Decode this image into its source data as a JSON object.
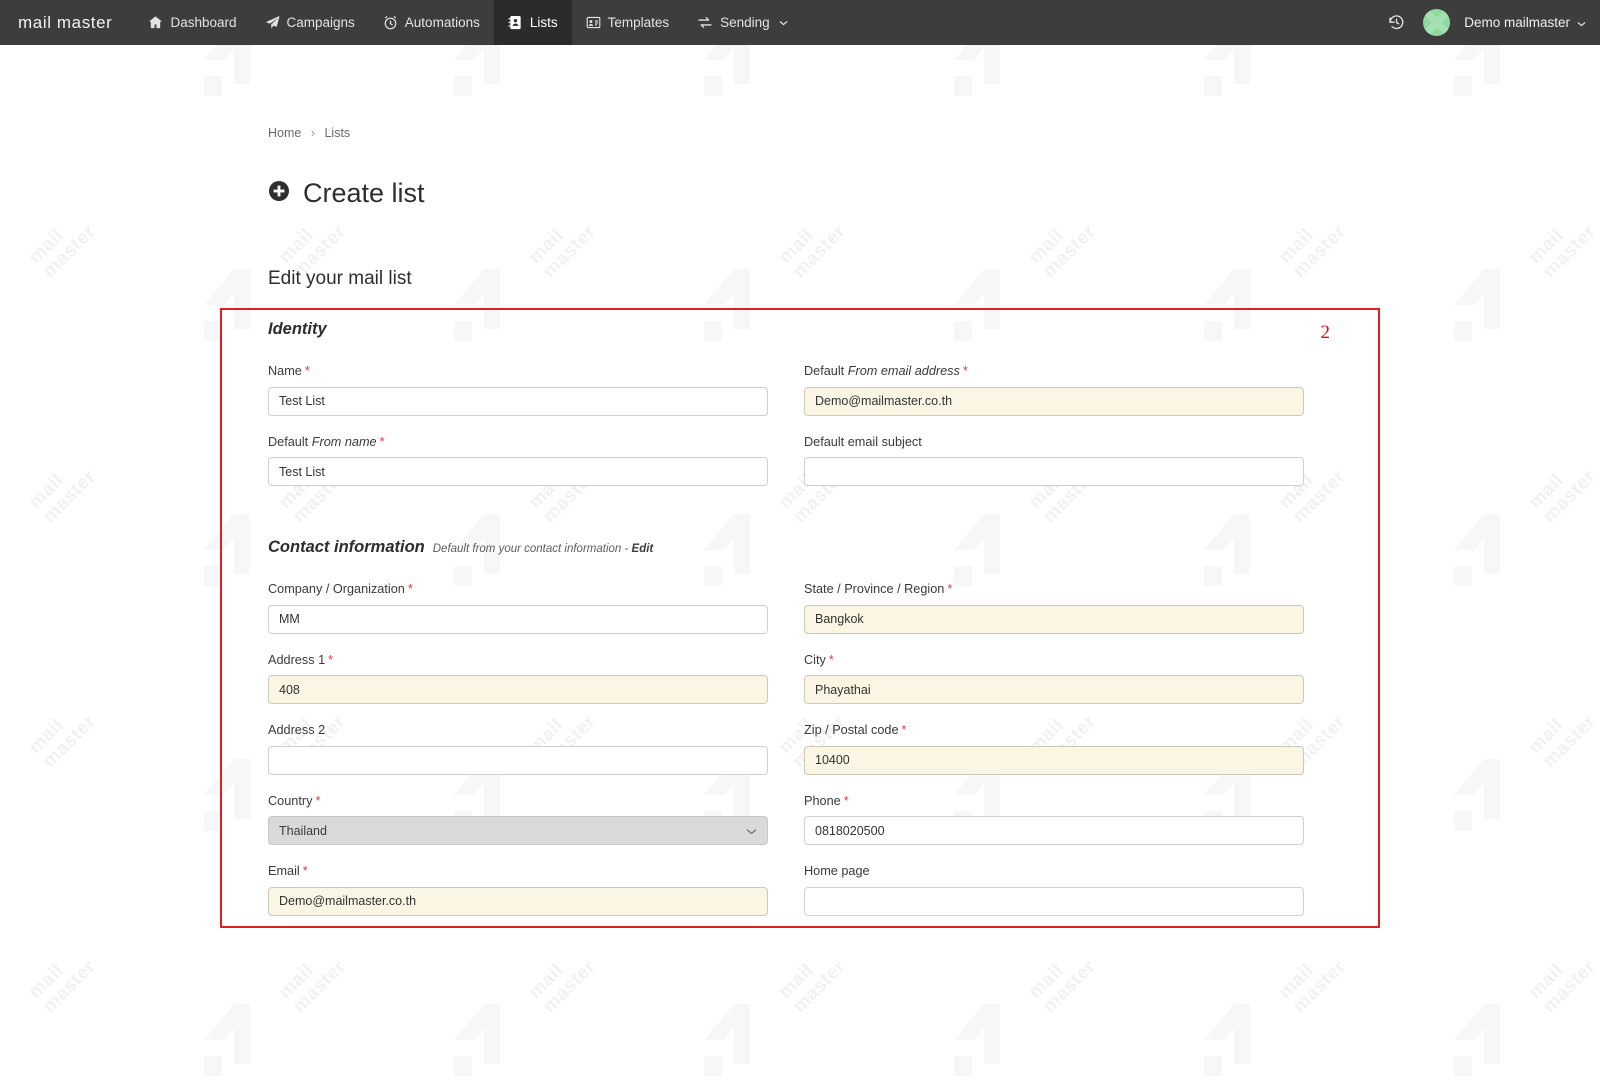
{
  "navbar": {
    "brand": "mail master",
    "items": [
      {
        "label": "Dashboard",
        "icon": "home-icon",
        "active": false
      },
      {
        "label": "Campaigns",
        "icon": "paper-plane-icon",
        "active": false
      },
      {
        "label": "Automations",
        "icon": "alarm-clock-icon",
        "active": false
      },
      {
        "label": "Lists",
        "icon": "address-book-icon",
        "active": true
      },
      {
        "label": "Templates",
        "icon": "id-card-icon",
        "active": false
      },
      {
        "label": "Sending",
        "icon": "transfer-icon",
        "active": false
      }
    ],
    "sending_caret": "⌄",
    "history_icon": "history-rewind-icon",
    "avatar_icon": "user-avatar",
    "user_name": "Demo mailmaster",
    "user_caret": "⌄",
    "background_color": "#3d3d3d",
    "active_tab_color": "#2b2b2b"
  },
  "breadcrumb": {
    "home": "Home",
    "separator": "›",
    "current": "Lists"
  },
  "page": {
    "title": "Create list",
    "title_icon": "plus-circle-icon",
    "section_title": "Edit your mail list"
  },
  "annotation": {
    "number": "2",
    "color": "#e02020"
  },
  "form": {
    "identity": {
      "heading": "Identity",
      "fields": [
        {
          "name": "list-name",
          "label_plain": "Name",
          "label_italic": "",
          "required": true,
          "value": "Test List",
          "placeholder": "",
          "autofilled": false,
          "type": "text",
          "column": "left"
        },
        {
          "name": "default-from-email-address",
          "label_plain": "Default ",
          "label_italic": "From email address",
          "required": true,
          "value": "Demo@mailmaster.co.th",
          "placeholder": "",
          "autofilled": true,
          "type": "text",
          "column": "right"
        },
        {
          "name": "default-from-name",
          "label_plain": "Default ",
          "label_italic": "From name",
          "required": true,
          "value": "Test List",
          "placeholder": "",
          "autofilled": false,
          "type": "text",
          "column": "left"
        },
        {
          "name": "default-email-subject",
          "label_plain": "Default email subject",
          "label_italic": "",
          "required": false,
          "value": "",
          "placeholder": "",
          "autofilled": false,
          "type": "text",
          "column": "right"
        }
      ]
    },
    "contact": {
      "heading": "Contact information",
      "subtitle_text": "Default from your contact information - ",
      "subtitle_link": "Edit",
      "fields": [
        {
          "name": "company-organization",
          "label_plain": "Company / Organization",
          "label_italic": "",
          "required": true,
          "value": "MM",
          "placeholder": "",
          "autofilled": false,
          "type": "text",
          "column": "left"
        },
        {
          "name": "state-province-region",
          "label_plain": "State / Province / Region",
          "label_italic": "",
          "required": true,
          "value": "Bangkok",
          "placeholder": "",
          "autofilled": true,
          "type": "text",
          "column": "right"
        },
        {
          "name": "address-1",
          "label_plain": "Address 1",
          "label_italic": "",
          "required": true,
          "value": "408",
          "placeholder": "",
          "autofilled": true,
          "type": "text",
          "column": "left"
        },
        {
          "name": "city",
          "label_plain": "City",
          "label_italic": "",
          "required": true,
          "value": "Phayathai",
          "placeholder": "",
          "autofilled": true,
          "type": "text",
          "column": "right"
        },
        {
          "name": "address-2",
          "label_plain": "Address 2",
          "label_italic": "",
          "required": false,
          "value": "",
          "placeholder": "",
          "autofilled": false,
          "type": "text",
          "column": "left"
        },
        {
          "name": "zip-postal-code",
          "label_plain": "Zip / Postal code",
          "label_italic": "",
          "required": true,
          "value": "10400",
          "placeholder": "",
          "autofilled": true,
          "type": "text",
          "column": "right"
        },
        {
          "name": "country",
          "label_plain": "Country",
          "label_italic": "",
          "required": true,
          "value": "Thailand",
          "placeholder": "",
          "autofilled": false,
          "type": "select",
          "column": "left"
        },
        {
          "name": "phone",
          "label_plain": "Phone",
          "label_italic": "",
          "required": true,
          "value": "0818020500",
          "placeholder": "",
          "autofilled": false,
          "type": "text",
          "column": "right"
        },
        {
          "name": "email",
          "label_plain": "Email",
          "label_italic": "",
          "required": true,
          "value": "Demo@mailmaster.co.th",
          "placeholder": "",
          "autofilled": true,
          "type": "text",
          "column": "left"
        },
        {
          "name": "home-page",
          "label_plain": "Home page",
          "label_italic": "",
          "required": false,
          "value": "",
          "placeholder": "",
          "autofilled": false,
          "type": "text",
          "column": "right"
        }
      ]
    }
  },
  "watermark": {
    "text": "mail\nmaster"
  }
}
